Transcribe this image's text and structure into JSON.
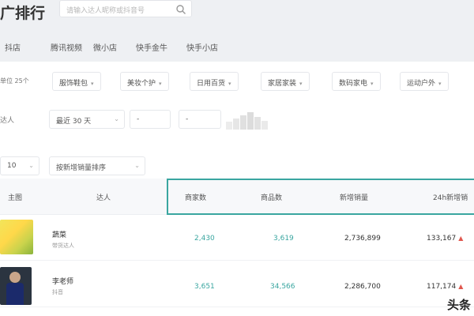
{
  "header": {
    "title": "广排行",
    "search_placeholder": "请输入达人昵称或抖音号"
  },
  "tabs": [
    "抖店",
    "腾讯视频",
    "微小店",
    "快手金牛",
    "快手小店"
  ],
  "filters": {
    "row1_label": "单位 25个",
    "categories": [
      "服饰鞋包",
      "美妆个护",
      "日用百货",
      "家居家装",
      "数码家电",
      "运动户外"
    ],
    "row2_label": "达人",
    "time_range": "最近 30 天",
    "from_value": "-",
    "to_value": "-"
  },
  "sort": {
    "page_size": "10",
    "sort_by": "按新增销量排序"
  },
  "table": {
    "headers": [
      "主图",
      "达人",
      "商家数",
      "商品数",
      "新增销量",
      "24h新增销"
    ],
    "rows": [
      {
        "name": "蔬菜",
        "sub": "带货达人",
        "shops": "2,430",
        "products": "3,619",
        "new_sales": "2,736,899",
        "sales_24h": "133,167"
      },
      {
        "name": "李老师",
        "sub": "抖音",
        "shops": "3,651",
        "products": "34,566",
        "new_sales": "2,286,700",
        "sales_24h": "117,174"
      }
    ]
  },
  "watermark": "头条",
  "colors": {
    "accent": "#3aa6a0",
    "up": "#e0574e"
  }
}
